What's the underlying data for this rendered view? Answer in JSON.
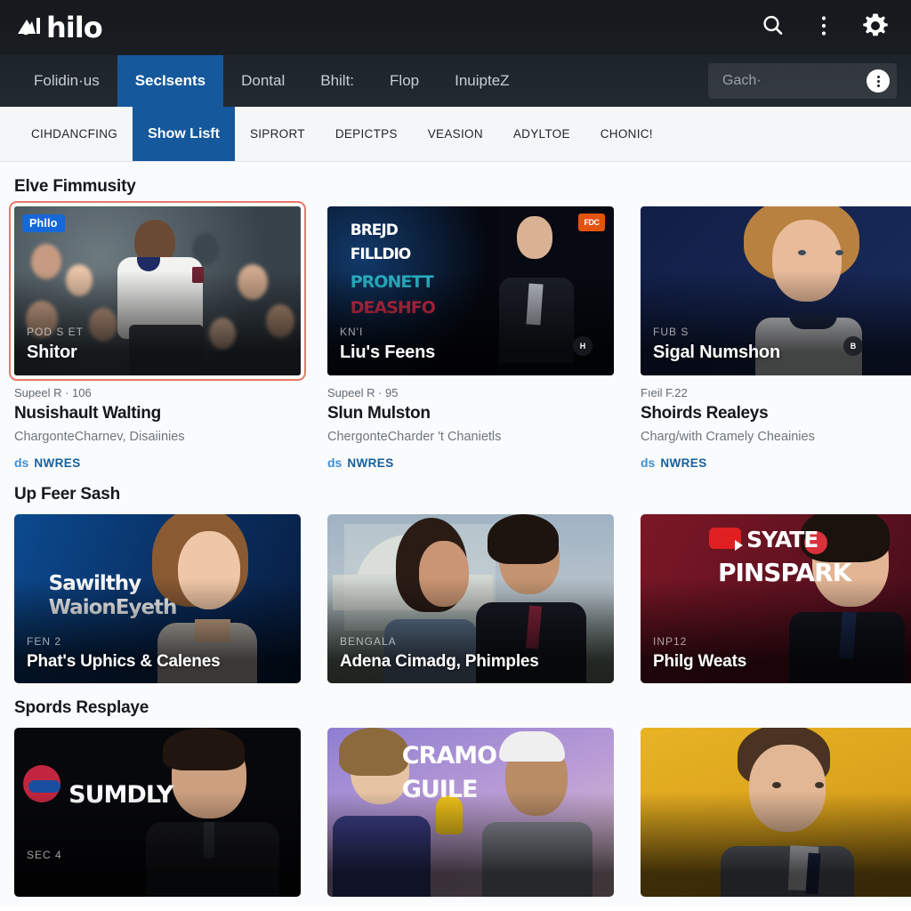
{
  "header": {
    "logo_text": "hilo",
    "logo_icon": "philo-logo-mark",
    "search_icon": "search-icon",
    "menu_icon": "kebab-menu-icon",
    "settings_icon": "gear-icon"
  },
  "primary_nav": {
    "items": [
      {
        "label": "Folidin·us",
        "active": false
      },
      {
        "label": "SecIsents",
        "active": true
      },
      {
        "label": "Dontal",
        "active": false
      },
      {
        "label": "Bhilt:",
        "active": false
      },
      {
        "label": "Flop",
        "active": false
      },
      {
        "label": "InuipteZ",
        "active": false
      }
    ],
    "search": {
      "placeholder": "Gach·",
      "button_icon": "kebab-menu-icon"
    }
  },
  "secondary_nav": {
    "items": [
      {
        "label": "CIHDANCFING",
        "active": false
      },
      {
        "label": "Show Lisft",
        "active": true
      },
      {
        "label": "SIPRORT",
        "active": false
      },
      {
        "label": "DEPICTPS",
        "active": false
      },
      {
        "label": "VEASION",
        "active": false
      },
      {
        "label": "ADYLTOE",
        "active": false
      },
      {
        "label": "CHONIC!",
        "active": false
      }
    ]
  },
  "sections": [
    {
      "title": "Elve Fimmusity",
      "type": "feature",
      "cards": [
        {
          "badge": "Phllo",
          "overlay_kicker": "POD S ET",
          "overlay_title": "Shitor",
          "meta_line": "Supeel R · 106",
          "meta_title": "Nusishault Walting",
          "meta_sub": "ChargonteCharnev, Disaiinies",
          "link_mark": "ds",
          "link_label": "NWRES",
          "selected": true
        },
        {
          "badge": "",
          "overlay_kicker": "KN'I",
          "overlay_title": "Liu's Feens",
          "meta_line": "Supeel R · 95",
          "meta_title": "Slun Mulston",
          "meta_sub": "ChergonteCharder 't Chanietls",
          "link_mark": "ds",
          "link_label": "NWRES",
          "selected": false
        },
        {
          "badge": "",
          "overlay_kicker": "FUB S",
          "overlay_title": "Sigal Numshon",
          "meta_line": "Fıeil F.22",
          "meta_title": "Shoirds Realeys",
          "meta_sub": "Charg/with Cramely Cheainies",
          "link_mark": "ds",
          "link_label": "NWRES",
          "selected": false
        }
      ]
    },
    {
      "title": "Up Feer Sash",
      "type": "wide",
      "cards": [
        {
          "art_top_line1": "Sawilthy",
          "art_top_line2": "WaionEyeth",
          "overlay_kicker": "FEN 2",
          "overlay_title": "Phat's Uphics & Calenes"
        },
        {
          "art_top_line1": "",
          "art_top_line2": "",
          "overlay_kicker": "BENGALA",
          "overlay_title": "Adena Cimadg, Phimples"
        },
        {
          "art_top_line1": "SYATE",
          "art_top_line2": "PINSPARK",
          "overlay_kicker": "INP12",
          "overlay_title": "Philg Weats"
        }
      ]
    },
    {
      "title": "Spords Resplaye",
      "type": "wide",
      "cards": [
        {
          "art_top_line1": "SUMDLY",
          "art_top_line2": "",
          "overlay_kicker": "SEC 4",
          "overlay_title": ""
        },
        {
          "art_top_line1": "CRAMO",
          "art_top_line2": "GUILE",
          "overlay_kicker": "",
          "overlay_title": ""
        },
        {
          "art_top_line1": "",
          "art_top_line2": "",
          "overlay_kicker": "",
          "overlay_title": ""
        }
      ]
    }
  ],
  "colors": {
    "accent_blue": "#15589c",
    "badge_blue": "#1668d8",
    "link_blue": "#16609e",
    "selection_red": "#e8786a",
    "header_dark": "#15181c"
  }
}
